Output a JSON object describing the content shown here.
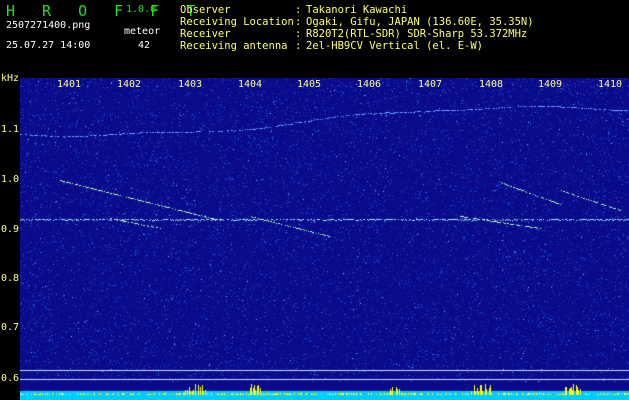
{
  "header": {
    "app_title": "H R O F F T",
    "app_version": "1.0.0",
    "file_name": "2507271400.png",
    "date_time": "25.07.27 14:00",
    "mode_label": "meteor",
    "count": "42"
  },
  "station_info": [
    {
      "label": "Observer",
      "value": "Takanori Kawachi"
    },
    {
      "label": "Receiving Location",
      "value": "Ogaki, Gifu, JAPAN (136.60E, 35.35N)"
    },
    {
      "label": "Receiver",
      "value": "R820T2(RTL-SDR) SDR-Sharp 53.372MHz"
    },
    {
      "label": "Receiving antenna",
      "value": "2el-HB9CV Vertical (el. E-W)"
    }
  ],
  "plot": {
    "unit_label": "kHz",
    "x_ticks": [
      "1401",
      "1402",
      "1403",
      "1404",
      "1405",
      "1406",
      "1407",
      "1408",
      "1409",
      "1410"
    ],
    "y_ticks": [
      "1.1",
      "1.0",
      "0.9",
      "0.8",
      "0.7",
      "0.6"
    ],
    "colors": {
      "background": "#0a0a8a",
      "noise": "#2a60ff",
      "signal": "#b0ffb0",
      "carrier": "#a0f0ff",
      "level_bar": "#00ccff",
      "level_peak": "#ffff00",
      "grid": "#ffff88"
    }
  }
}
